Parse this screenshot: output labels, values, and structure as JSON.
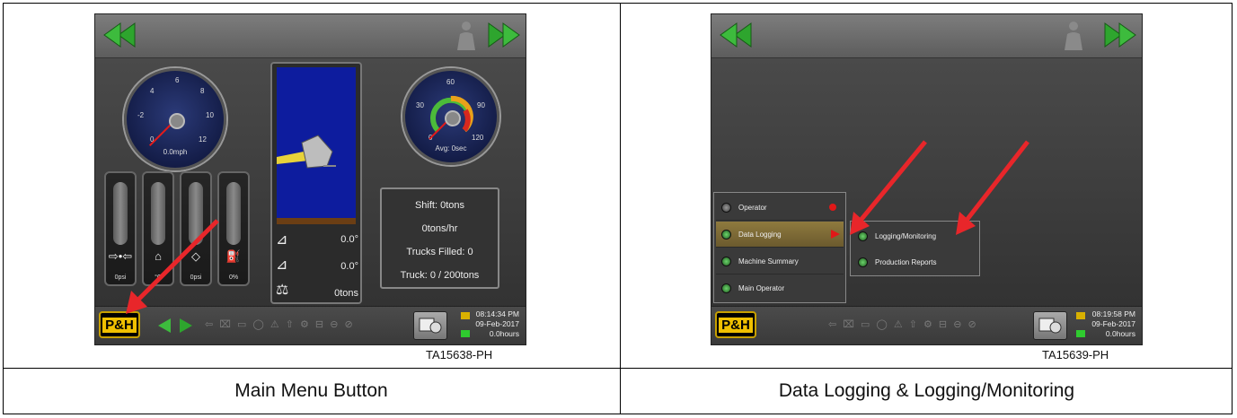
{
  "left_panel": {
    "caption": "Main Menu Button",
    "figure_id": "TA15638-PH",
    "speed_gauge": {
      "ticks": [
        "0",
        "-2",
        "4",
        "6",
        "8",
        "10",
        "12"
      ],
      "readout": "0.0mph"
    },
    "cycle_gauge": {
      "ticks": [
        "0",
        "30",
        "60",
        "90",
        "120"
      ],
      "readout": "Avg: 0sec"
    },
    "bar_gauges": [
      {
        "icon": "pump-icon",
        "glyph": "⇨•⇦",
        "value": "0psi"
      },
      {
        "icon": "temperature-icon",
        "glyph": "⌂",
        "value": "°C"
      },
      {
        "icon": "oil-pressure-icon",
        "glyph": "◇",
        "value": "0psi"
      },
      {
        "icon": "fuel-icon",
        "glyph": "⛽",
        "value": "0%"
      }
    ],
    "bucket": {
      "angle1": "0.0°",
      "angle2": "0.0°",
      "payload": "0tons"
    },
    "production": {
      "shift": "Shift: 0tons",
      "rate": "0tons/hr",
      "trucks_filled": "Trucks Filled: 0",
      "truck": "Truck: 0 / 200tons"
    },
    "bottom_bar": {
      "logo": "P&H",
      "clock_time": "08:14:34 PM",
      "clock_date": "09-Feb-2017",
      "clock_hours": "0.0hours"
    }
  },
  "right_panel": {
    "caption": "Data Logging & Logging/Monitoring",
    "figure_id": "TA15639-PH",
    "menu": [
      {
        "label": "Operator",
        "led": "off",
        "indicator": "red"
      },
      {
        "label": "Data Logging",
        "led": "on",
        "indicator": "arrow",
        "active": true
      },
      {
        "label": "Machine Summary",
        "led": "on"
      },
      {
        "label": "Main Operator",
        "led": "on"
      }
    ],
    "submenu": [
      {
        "label": "Logging/Monitoring"
      },
      {
        "label": "Production Reports"
      }
    ],
    "bottom_bar": {
      "logo": "P&H",
      "clock_time": "08:19:58 PM",
      "clock_date": "09-Feb-2017",
      "clock_hours": "0.0hours"
    }
  },
  "colors": {
    "nav_arrow": "#2ea52e",
    "callout_arrow": "#e8262a",
    "logo_yellow": "#f0c000",
    "bucket_sky": "#0d1c9e"
  }
}
